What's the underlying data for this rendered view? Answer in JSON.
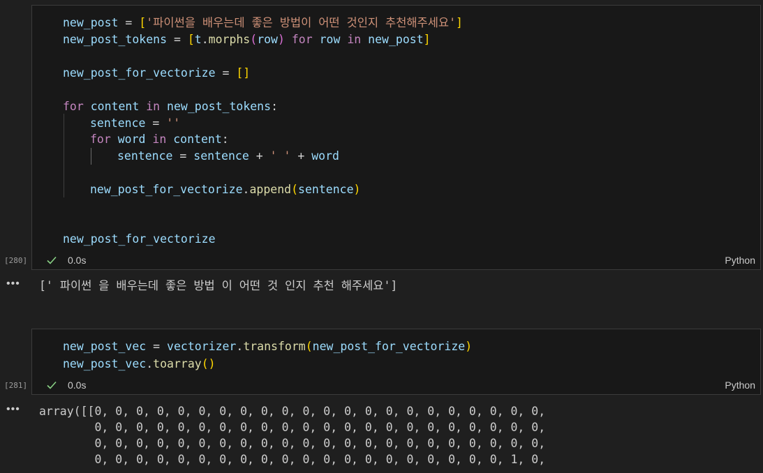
{
  "cell1": {
    "execution_count": "[280]",
    "status_icon": "check-icon",
    "duration": "0.0s",
    "language": "Python",
    "code": {
      "l1_var": "new_post",
      "l1_eq": " = ",
      "l1_br_open": "[",
      "l1_str": "'파이썬을 배우는데 좋은 방법이 어떤 것인지 추천해주세요'",
      "l1_br_close": "]",
      "l2_var": "new_post_tokens",
      "l2_eq": " = ",
      "l2_br_open": "[",
      "l2_obj": "t",
      "l2_dot": ".",
      "l2_fn": "morphs",
      "l2_paren_open": "(",
      "l2_arg": "row",
      "l2_paren_close": ")",
      "l2_for": " for ",
      "l2_row": "row",
      "l2_in": " in ",
      "l2_src": "new_post",
      "l2_br_close": "]",
      "l3_var": "new_post_for_vectorize",
      "l3_eq": " = ",
      "l3_list": "[]",
      "l4_for": "for",
      "l4_var": " content",
      "l4_in": " in ",
      "l4_src": "new_post_tokens",
      "l4_colon": ":",
      "l5_var": "sentence",
      "l5_eq": " = ",
      "l5_str": "''",
      "l6_for": "for",
      "l6_var": " word",
      "l6_in": " in ",
      "l6_src": "content",
      "l6_colon": ":",
      "l7_var": "sentence",
      "l7_eq": " = ",
      "l7_var2": "sentence",
      "l7_plus": " + ",
      "l7_str": "' '",
      "l7_plus2": " + ",
      "l7_word": "word",
      "l8_obj": "new_post_for_vectorize",
      "l8_dot": ".",
      "l8_fn": "append",
      "l8_po": "(",
      "l8_arg": "sentence",
      "l8_pc": ")",
      "l9_var": "new_post_for_vectorize"
    },
    "output": "[' 파이썬 을 배우는데 좋은 방법 이 어떤 것 인지 추천 해주세요']"
  },
  "cell2": {
    "execution_count": "[281]",
    "status_icon": "check-icon",
    "duration": "0.0s",
    "language": "Python",
    "code": {
      "l1_var": "new_post_vec",
      "l1_eq": " = ",
      "l1_obj": "vectorizer",
      "l1_dot": ".",
      "l1_fn": "transform",
      "l1_po": "(",
      "l1_arg": "new_post_for_vectorize",
      "l1_pc": ")",
      "l2_obj": "new_post_vec",
      "l2_dot": ".",
      "l2_fn": "toarray",
      "l2_parens": "()"
    },
    "output_lines": [
      "array([[0, 0, 0, 0, 0, 0, 0, 0, 0, 0, 0, 0, 0, 0, 0, 0, 0, 0, 0, 0, 0, 0,",
      "        0, 0, 0, 0, 0, 0, 0, 0, 0, 0, 0, 0, 0, 0, 0, 0, 0, 0, 0, 0, 0, 0,",
      "        0, 0, 0, 0, 0, 0, 0, 0, 0, 0, 0, 0, 0, 0, 0, 0, 0, 0, 0, 0, 0, 0,",
      "        0, 0, 0, 0, 0, 0, 0, 0, 0, 0, 0, 0, 0, 0, 0, 0, 0, 0, 0, 0, 1, 0,"
    ]
  },
  "output_menu_icon": "ellipsis-icon",
  "colors": {
    "background": "#1f1f1f",
    "cell_background": "#181818",
    "variable": "#9cdcfe",
    "string": "#ce9178",
    "keyword": "#c586c0",
    "function": "#dcdcaa",
    "bracket_gold": "#ffd700",
    "bracket_pink": "#da70d6",
    "bracket_blue": "#179fff",
    "success_check": "#89d185"
  }
}
